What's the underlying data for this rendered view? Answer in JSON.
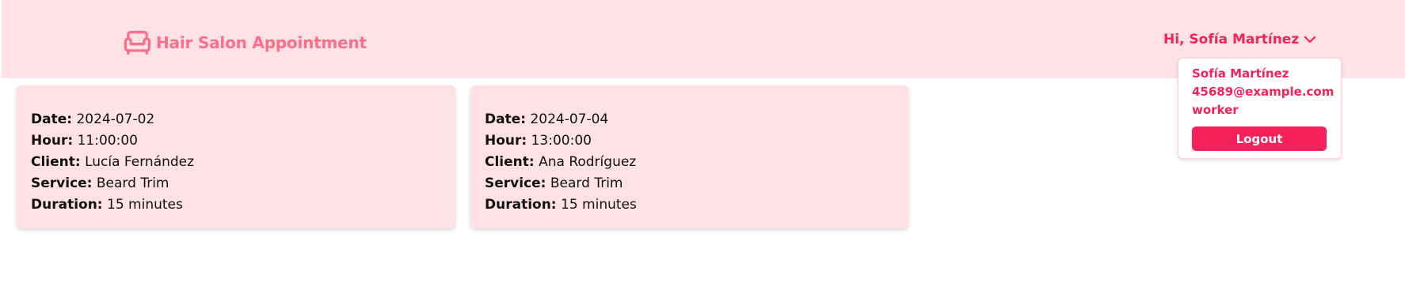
{
  "header": {
    "app_title": "Hair Salon Appointment",
    "logo_icon": "armchair-icon",
    "greeting": "Hi, Sofía Martínez",
    "dropdown_icon": "chevron-down-icon",
    "colors": {
      "header_bg": "#ffe2e5",
      "brand": "#fc6f8a",
      "accent": "#f1245a",
      "button": "#f8215b"
    }
  },
  "user_menu": {
    "name": "Sofía Martínez",
    "email": "45689@example.com",
    "role": "worker",
    "logout_label": "Logout"
  },
  "labels": {
    "date": "Date:",
    "hour": "Hour:",
    "client": "Client:",
    "service": "Service:",
    "duration": "Duration:"
  },
  "appointments": [
    {
      "date": "2024-07-02",
      "hour": "11:00:00",
      "client": "Lucía Fernández",
      "service": "Beard Trim",
      "duration": "15 minutes"
    },
    {
      "date": "2024-07-04",
      "hour": "13:00:00",
      "client": "Ana Rodríguez",
      "service": "Beard Trim",
      "duration": "15 minutes"
    }
  ]
}
